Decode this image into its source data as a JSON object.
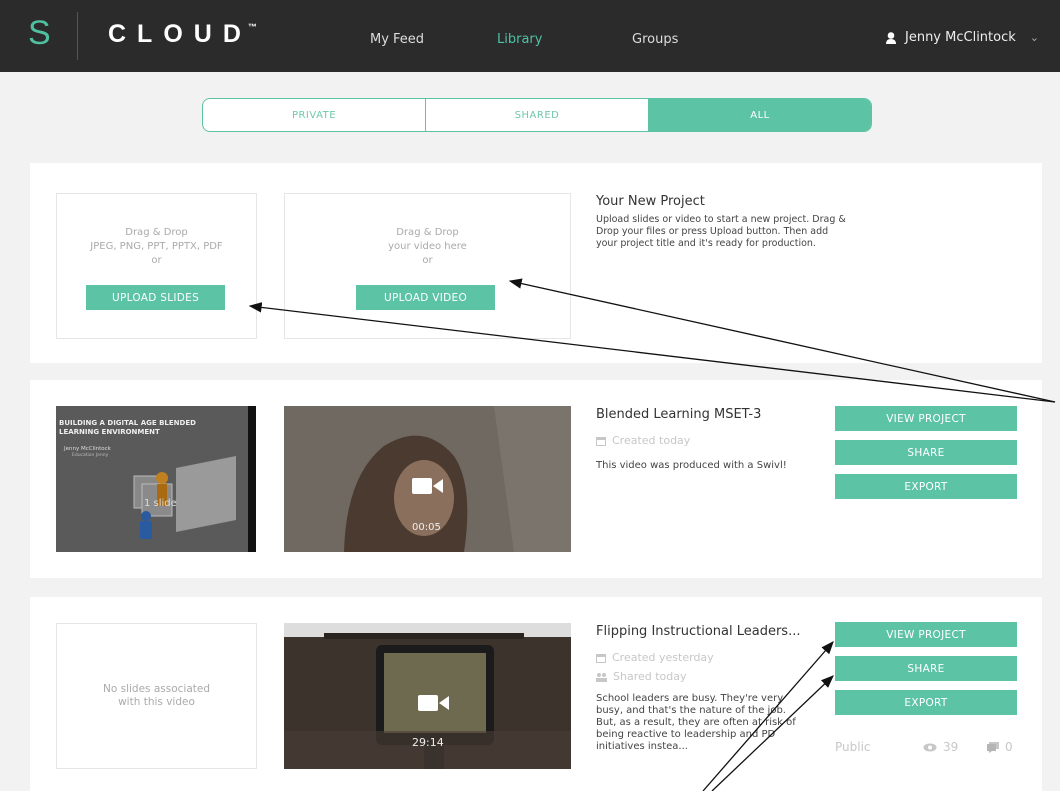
{
  "header": {
    "logo_letter": "S",
    "logo_text": "CLOUD",
    "logo_tm": "™",
    "nav": [
      "My Feed",
      "Library",
      "Groups"
    ],
    "active_nav": "Library",
    "user_name": "Jenny McClintock"
  },
  "filter_tabs": [
    "PRIVATE",
    "SHARED",
    "ALL"
  ],
  "active_filter": "ALL",
  "new_project": {
    "slides_drop": [
      "Drag & Drop",
      "JPEG, PNG, PPT, PPTX, PDF",
      "or"
    ],
    "upload_slides": "UPLOAD SLIDES",
    "video_drop": [
      "Drag & Drop",
      "your video here",
      "or"
    ],
    "upload_video": "UPLOAD VIDEO",
    "title": "Your New Project",
    "description": "Upload slides or video to start a new project. Drag & Drop your files or press Upload button. Then add your project title and it's ready for production."
  },
  "projects": [
    {
      "slide_title": "BUILDING A DIGITAL AGE BLENDED LEARNING ENVIRONMENT",
      "slide_author": "Jenny McClintock",
      "slide_sub": "Education Jenny",
      "slide_count": "1 slide",
      "video_duration": "00:05",
      "title": "Blended Learning MSET-3",
      "created": "Created today",
      "description": "This video was produced with a Swivl!",
      "buttons": [
        "VIEW PROJECT",
        "SHARE",
        "EXPORT"
      ]
    },
    {
      "no_slides": "No slides associated with this video",
      "video_duration": "29:14",
      "title": "Flipping Instructional Leaders...",
      "created": "Created yesterday",
      "shared": "Shared today",
      "description": "School leaders are busy. They're very busy, and that's the nature of the job. But, as a result, they are often at risk of being reactive to leadership and PD initiatives instea...",
      "buttons": [
        "VIEW PROJECT",
        "SHARE",
        "EXPORT"
      ],
      "visibility": "Public",
      "views": "39",
      "comments": "0"
    }
  ],
  "colors": {
    "accent": "#5cc3a4",
    "topbar": "#2b2b2b",
    "background": "#f2f2f2"
  }
}
